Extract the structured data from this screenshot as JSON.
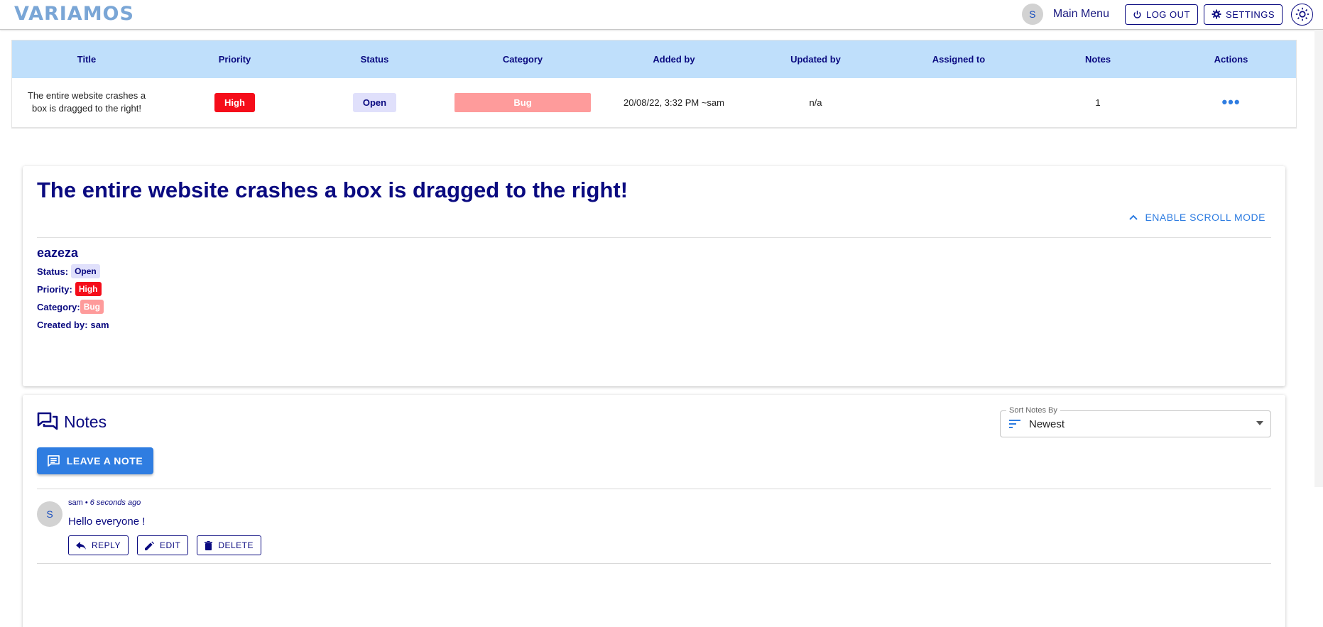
{
  "app": {
    "logo_text": "VARIAMOS",
    "user_initial": "S",
    "main_menu": "Main Menu",
    "logout_label": "LOG OUT",
    "settings_label": "SETTINGS"
  },
  "table": {
    "headers": [
      "Title",
      "Priority",
      "Status",
      "Category",
      "Added by",
      "Updated by",
      "Assigned to",
      "Notes",
      "Actions"
    ],
    "row": {
      "title": "The entire website crashes a box is dragged to the right!",
      "priority": "High",
      "status": "Open",
      "category": "Bug",
      "added_by": "20/08/22, 3:32 PM ~sam",
      "updated_by": "n/a",
      "assigned_to": "",
      "notes": "1"
    }
  },
  "detail": {
    "title": "The entire website crashes a box is dragged to the right!",
    "scroll_mode_label": "ENABLE SCROLL MODE",
    "description": "eazeza",
    "status_label": "Status:",
    "status_value": "Open",
    "priority_label": "Priority:",
    "priority_value": "High",
    "category_label": "Category:",
    "category_value": "Bug",
    "created_by_label": "Created by:",
    "created_by_value": "sam"
  },
  "notes": {
    "heading": "Notes",
    "sort_label": "Sort Notes By",
    "sort_value": "Newest",
    "leave_note_label": "LEAVE A NOTE",
    "items": [
      {
        "author": "sam",
        "time": "6 seconds ago",
        "avatar_initial": "S",
        "text": "Hello everyone !",
        "reply_label": "REPLY",
        "edit_label": "EDIT",
        "delete_label": "DELETE"
      }
    ]
  },
  "colors": {
    "primary": "#2f7de1",
    "navy": "#0a0a80",
    "header_bg": "#bfdffb",
    "high": "#f50d1a",
    "open": "#e0e0fb",
    "bug": "#fe9b9b"
  }
}
